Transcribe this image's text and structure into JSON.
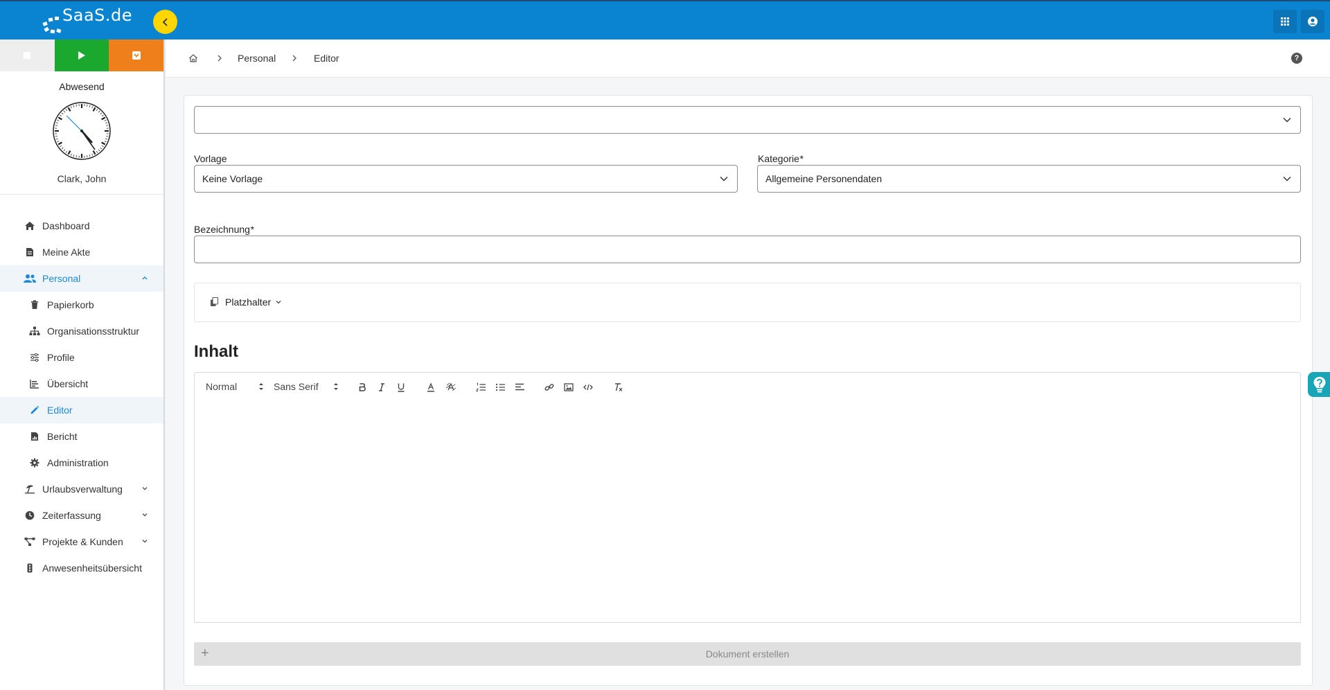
{
  "app": {
    "logo_text": "SaaS.de"
  },
  "timer": {
    "status": "Abwesend",
    "user_name": "Clark, John"
  },
  "sidebar": {
    "items": [
      {
        "label": "Dashboard"
      },
      {
        "label": "Meine Akte"
      },
      {
        "label": "Personal"
      },
      {
        "label": "Papierkorb"
      },
      {
        "label": "Organisationsstruktur"
      },
      {
        "label": "Profile"
      },
      {
        "label": "Übersicht"
      },
      {
        "label": "Editor"
      },
      {
        "label": "Bericht"
      },
      {
        "label": "Administration"
      },
      {
        "label": "Urlaubsverwaltung"
      },
      {
        "label": "Zeiterfassung"
      },
      {
        "label": "Projekte & Kunden"
      },
      {
        "label": "Anwesenheitsübersicht"
      }
    ]
  },
  "breadcrumb": {
    "level1": "Personal",
    "level2": "Editor"
  },
  "form": {
    "top_select_value": "",
    "vorlage_label": "Vorlage",
    "vorlage_value": "Keine Vorlage",
    "kategorie_label": "Kategorie",
    "kategorie_value": "Allgemeine Personendaten",
    "bezeichnung_label": "Bezeichnung",
    "bezeichnung_value": "",
    "required_marker": "*",
    "placeholder_button": "Platzhalter",
    "content_heading": "Inhalt",
    "toolbar": {
      "size": "Normal",
      "font": "Sans Serif"
    },
    "create_button": "Dokument erstellen"
  },
  "colors": {
    "topbar": "#0a84d0",
    "accent": "#1e88d6",
    "stop": "#eeeeee",
    "play": "#1ba82e",
    "pause": "#ef7f1a",
    "collapse": "#ffd600",
    "help": "#17a5b8"
  }
}
